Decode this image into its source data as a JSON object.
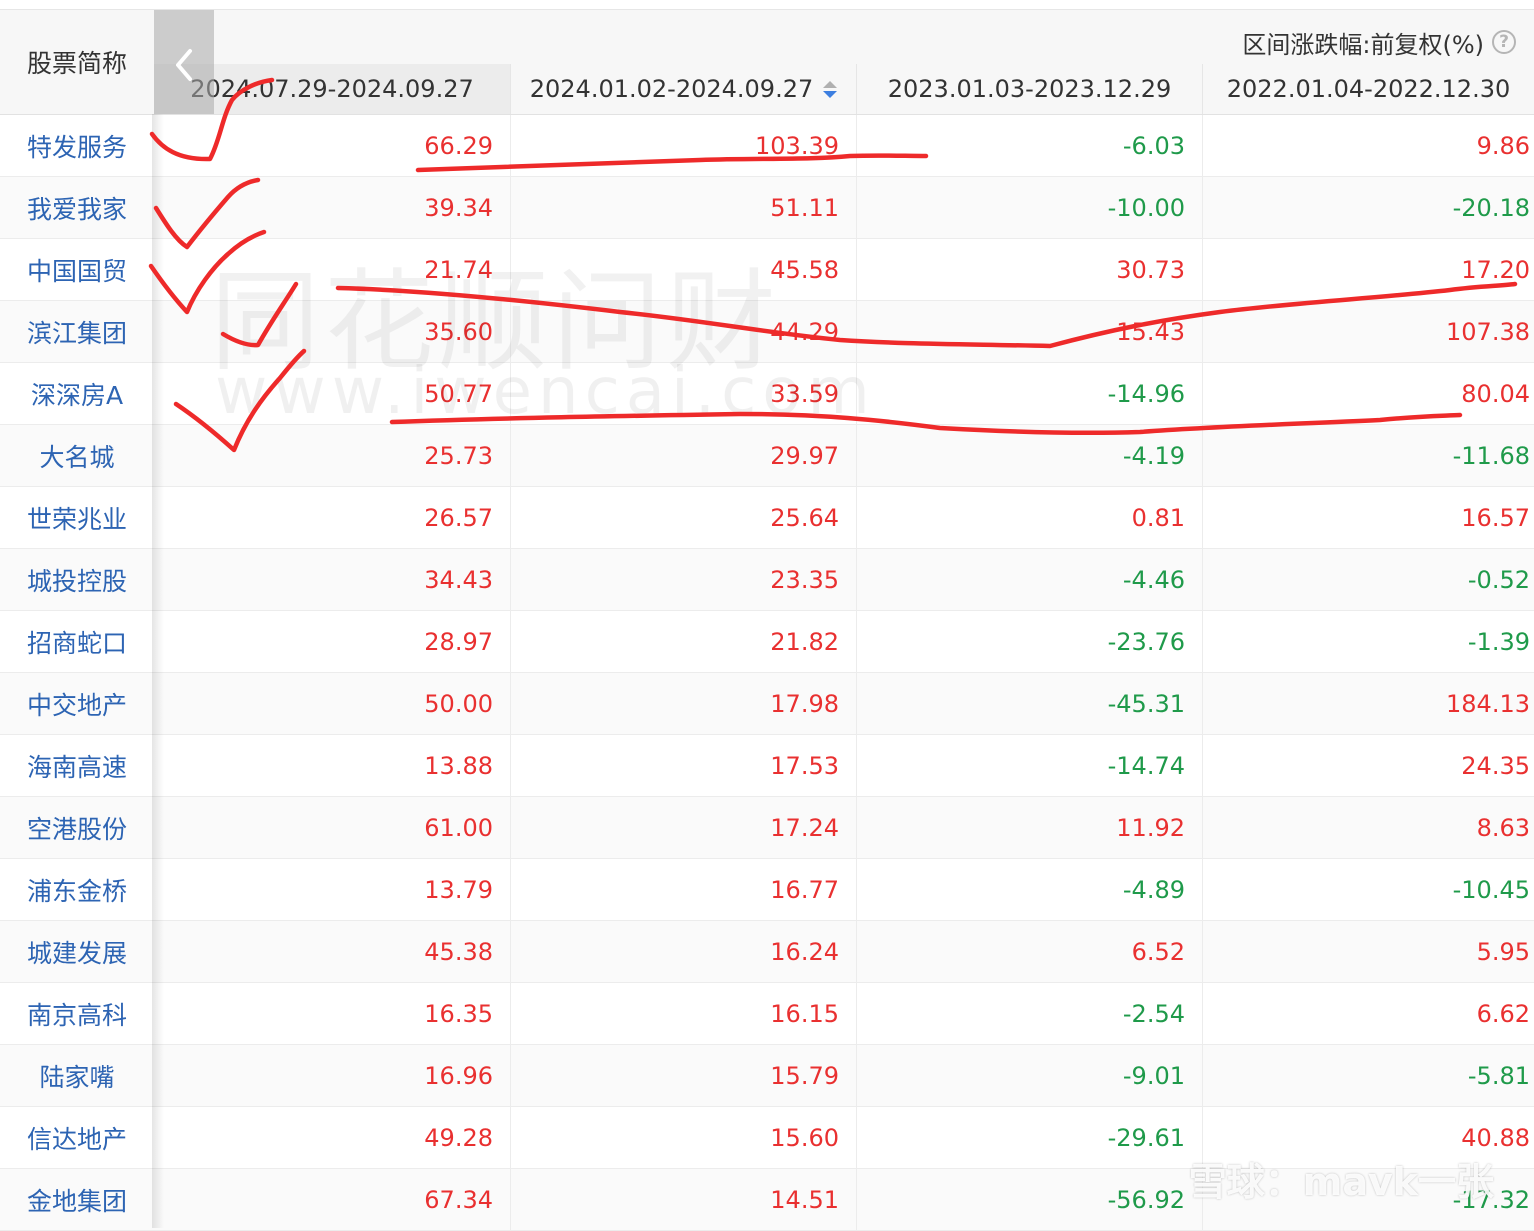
{
  "table": {
    "name_header": "股票简称",
    "group_header": "区间涨跌幅:前复权(%)",
    "columns": [
      "2024.07.29-2024.09.27",
      "2024.01.02-2024.09.27",
      "2023.01.03-2023.12.29",
      "2022.01.04-2022.12.30"
    ],
    "sorted_column_index": 1,
    "sort_direction": "desc",
    "rows": [
      {
        "name": "特发服务",
        "values": [
          "66.29",
          "103.39",
          "-6.03",
          "9.86"
        ]
      },
      {
        "name": "我爱我家",
        "values": [
          "39.34",
          "51.11",
          "-10.00",
          "-20.18"
        ]
      },
      {
        "name": "中国国贸",
        "values": [
          "21.74",
          "45.58",
          "30.73",
          "17.20"
        ]
      },
      {
        "name": "滨江集团",
        "values": [
          "35.60",
          "44.29",
          "15.43",
          "107.38"
        ]
      },
      {
        "name": "深深房A",
        "values": [
          "50.77",
          "33.59",
          "-14.96",
          "80.04"
        ]
      },
      {
        "name": "大名城",
        "values": [
          "25.73",
          "29.97",
          "-4.19",
          "-11.68"
        ]
      },
      {
        "name": "世荣兆业",
        "values": [
          "26.57",
          "25.64",
          "0.81",
          "16.57"
        ]
      },
      {
        "name": "城投控股",
        "values": [
          "34.43",
          "23.35",
          "-4.46",
          "-0.52"
        ]
      },
      {
        "name": "招商蛇口",
        "values": [
          "28.97",
          "21.82",
          "-23.76",
          "-1.39"
        ]
      },
      {
        "name": "中交地产",
        "values": [
          "50.00",
          "17.98",
          "-45.31",
          "184.13"
        ]
      },
      {
        "name": "海南高速",
        "values": [
          "13.88",
          "17.53",
          "-14.74",
          "24.35"
        ]
      },
      {
        "name": "空港股份",
        "values": [
          "61.00",
          "17.24",
          "11.92",
          "8.63"
        ]
      },
      {
        "name": "浦东金桥",
        "values": [
          "13.79",
          "16.77",
          "-4.89",
          "-10.45"
        ]
      },
      {
        "name": "城建发展",
        "values": [
          "45.38",
          "16.24",
          "6.52",
          "5.95"
        ]
      },
      {
        "name": "南京高科",
        "values": [
          "16.35",
          "16.15",
          "-2.54",
          "6.62"
        ]
      },
      {
        "name": "陆家嘴",
        "values": [
          "16.96",
          "15.79",
          "-9.01",
          "-5.81"
        ]
      },
      {
        "name": "信达地产",
        "values": [
          "49.28",
          "15.60",
          "-29.61",
          "40.88"
        ]
      },
      {
        "name": "金地集团",
        "values": [
          "67.34",
          "14.51",
          "-56.92",
          "-17.32"
        ]
      }
    ]
  },
  "icons": {
    "scroll_left": "chevron-left-icon",
    "help": "question-circle-icon",
    "sort": "sort-icon"
  },
  "watermark": {
    "brand": "同花顺问财",
    "url": "www.iwencai.com"
  },
  "credit": "雪球：mavk一张",
  "colors": {
    "positive": "#e93030",
    "negative": "#1f9a4a",
    "stock_link": "#2d64b3",
    "sort_active": "#3d7fe0",
    "annotation": "#ee2a2a"
  }
}
